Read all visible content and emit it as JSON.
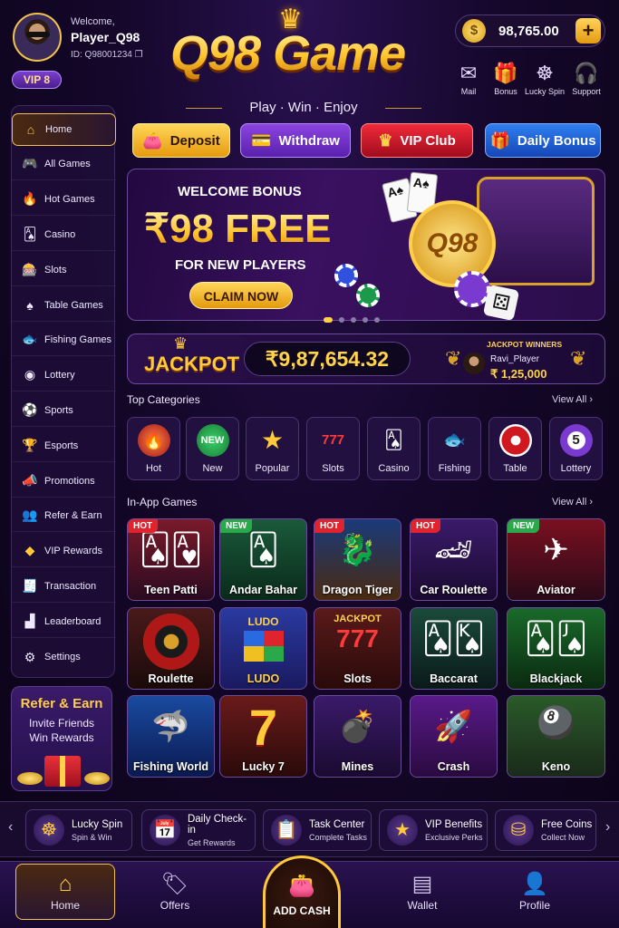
{
  "user": {
    "welcome": "Welcome,",
    "name": "Player_Q98",
    "id": "ID: Q98001234",
    "vip": "VIP 8"
  },
  "brand": {
    "title": "Q98 Game",
    "tagline": "Play · Win · Enjoy"
  },
  "wallet": {
    "balance": "98,765.00",
    "coin_symbol": "$"
  },
  "quick_icons": [
    {
      "label": "Mail",
      "icon": "mail-icon"
    },
    {
      "label": "Bonus",
      "icon": "gift-icon"
    },
    {
      "label": "Lucky Spin",
      "icon": "wheel-icon"
    },
    {
      "label": "Support",
      "icon": "headset-icon"
    }
  ],
  "actions": {
    "deposit": "Deposit",
    "withdraw": "Withdraw",
    "vip_club": "VIP Club",
    "daily_bonus": "Daily Bonus"
  },
  "sidebar": {
    "items": [
      {
        "label": "Home",
        "icon": "home-icon"
      },
      {
        "label": "All Games",
        "icon": "gamepad-icon"
      },
      {
        "label": "Hot Games",
        "icon": "flame-icon"
      },
      {
        "label": "Casino",
        "icon": "cards-icon"
      },
      {
        "label": "Slots",
        "icon": "slots-icon"
      },
      {
        "label": "Table Games",
        "icon": "table-icon"
      },
      {
        "label": "Fishing Games",
        "icon": "fish-icon"
      },
      {
        "label": "Lottery",
        "icon": "lottery-icon"
      },
      {
        "label": "Sports",
        "icon": "ball-icon"
      },
      {
        "label": "Esports",
        "icon": "trophy-icon"
      },
      {
        "label": "Promotions",
        "icon": "promo-icon"
      },
      {
        "label": "Refer & Earn",
        "icon": "users-icon"
      },
      {
        "label": "VIP Rewards",
        "icon": "diamond-icon"
      },
      {
        "label": "Transaction",
        "icon": "receipt-icon"
      },
      {
        "label": "Leaderboard",
        "icon": "podium-icon"
      },
      {
        "label": "Settings",
        "icon": "gear-icon"
      }
    ]
  },
  "refer": {
    "title": "Refer & Earn",
    "line1": "Invite Friends",
    "line2": "Win Rewards"
  },
  "banner": {
    "heading": "WELCOME BONUS",
    "amount": "₹98 FREE",
    "subheading": "FOR NEW PLAYERS",
    "cta": "CLAIM NOW",
    "coin_text": "Q98",
    "slide": 1,
    "slides": 5
  },
  "jackpot": {
    "label": "JACKPOT",
    "amount": "₹9,87,654.32",
    "winners_title": "JACKPOT WINNERS",
    "winner_name": "Ravi_Player",
    "winner_amount": "₹ 1,25,000"
  },
  "categories_section": {
    "title": "Top Categories",
    "view_all": "View All"
  },
  "categories": [
    {
      "label": "Hot",
      "icon": "flame-icon",
      "color": "#e0242e"
    },
    {
      "label": "New",
      "icon": "new-badge-icon",
      "color": "#2aa84a"
    },
    {
      "label": "Popular",
      "icon": "star-icon",
      "color": "#f0b020"
    },
    {
      "label": "Slots",
      "icon": "slots-icon",
      "color": "#c01828"
    },
    {
      "label": "Casino",
      "icon": "cards-icon",
      "color": "#ffffff"
    },
    {
      "label": "Fishing",
      "icon": "fish-icon",
      "color": "#2a8ae0"
    },
    {
      "label": "Table",
      "icon": "roulette-icon",
      "color": "#d01820"
    },
    {
      "label": "Lottery",
      "icon": "lottery-ball-icon",
      "color": "#7a3ad0"
    }
  ],
  "games_section": {
    "title": "In-App Games",
    "view_all": "View All"
  },
  "games": [
    {
      "label": "Teen Patti",
      "badge": "HOT"
    },
    {
      "label": "Andar Bahar",
      "badge": "NEW"
    },
    {
      "label": "Dragon Tiger",
      "badge": "HOT"
    },
    {
      "label": "Car Roulette",
      "badge": "HOT"
    },
    {
      "label": "Aviator",
      "badge": "NEW"
    },
    {
      "label": "Roulette",
      "badge": ""
    },
    {
      "label": "LUDO",
      "badge": ""
    },
    {
      "label": "Slots",
      "badge": ""
    },
    {
      "label": "Baccarat",
      "badge": ""
    },
    {
      "label": "Blackjack",
      "badge": ""
    },
    {
      "label": "Fishing World",
      "badge": ""
    },
    {
      "label": "Lucky 7",
      "badge": ""
    },
    {
      "label": "Mines",
      "badge": ""
    },
    {
      "label": "Crash",
      "badge": ""
    },
    {
      "label": "Keno",
      "badge": ""
    }
  ],
  "game_art": {
    "ludo_sign": "LUDO",
    "slots_sign": "JACKPOT",
    "slots_reels": "777",
    "lucky7": "7"
  },
  "promos": [
    {
      "title": "Lucky Spin",
      "sub": "Spin & Win",
      "icon": "wheel-icon"
    },
    {
      "title": "Daily Check-in",
      "sub": "Get Rewards",
      "icon": "calendar-icon"
    },
    {
      "title": "Task Center",
      "sub": "Complete Tasks",
      "icon": "clipboard-icon"
    },
    {
      "title": "VIP Benefits",
      "sub": "Exclusive Perks",
      "icon": "star-icon"
    },
    {
      "title": "Free Coins",
      "sub": "Collect Now",
      "icon": "coins-icon"
    }
  ],
  "nav": {
    "home": "Home",
    "offers": "Offers",
    "add_cash": "ADD CASH",
    "wallet": "Wallet",
    "profile": "Profile"
  }
}
